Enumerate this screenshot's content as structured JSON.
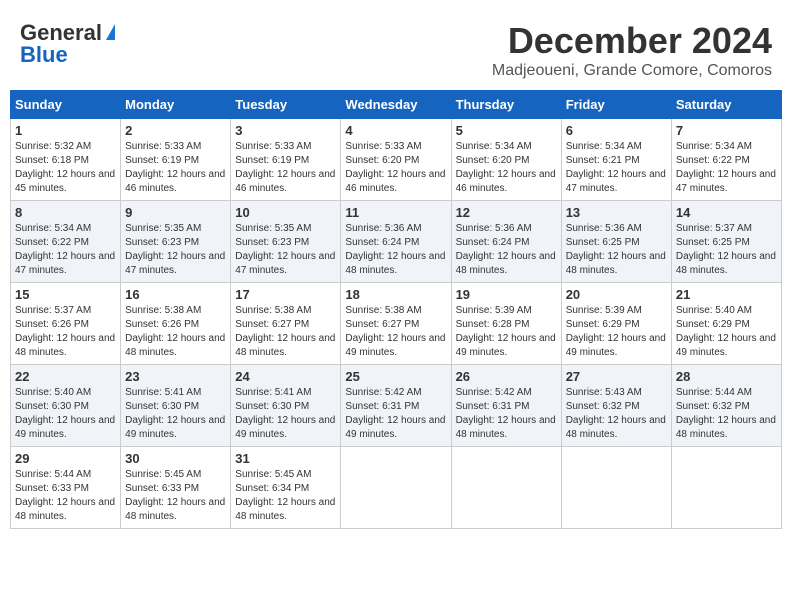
{
  "header": {
    "logo_line1": "General",
    "logo_line2": "Blue",
    "title": "December 2024",
    "subtitle": "Madjeoueni, Grande Comore, Comoros"
  },
  "calendar": {
    "days_of_week": [
      "Sunday",
      "Monday",
      "Tuesday",
      "Wednesday",
      "Thursday",
      "Friday",
      "Saturday"
    ],
    "weeks": [
      [
        null,
        {
          "day": "2",
          "sunrise": "5:33 AM",
          "sunset": "6:19 PM",
          "daylight": "12 hours and 46 minutes."
        },
        {
          "day": "3",
          "sunrise": "5:33 AM",
          "sunset": "6:19 PM",
          "daylight": "12 hours and 46 minutes."
        },
        {
          "day": "4",
          "sunrise": "5:33 AM",
          "sunset": "6:20 PM",
          "daylight": "12 hours and 46 minutes."
        },
        {
          "day": "5",
          "sunrise": "5:34 AM",
          "sunset": "6:20 PM",
          "daylight": "12 hours and 46 minutes."
        },
        {
          "day": "6",
          "sunrise": "5:34 AM",
          "sunset": "6:21 PM",
          "daylight": "12 hours and 47 minutes."
        },
        {
          "day": "7",
          "sunrise": "5:34 AM",
          "sunset": "6:22 PM",
          "daylight": "12 hours and 47 minutes."
        }
      ],
      [
        {
          "day": "1",
          "sunrise": "5:32 AM",
          "sunset": "6:18 PM",
          "daylight": "12 hours and 45 minutes."
        },
        {
          "day": "9",
          "sunrise": "5:35 AM",
          "sunset": "6:23 PM",
          "daylight": "12 hours and 47 minutes."
        },
        {
          "day": "10",
          "sunrise": "5:35 AM",
          "sunset": "6:23 PM",
          "daylight": "12 hours and 47 minutes."
        },
        {
          "day": "11",
          "sunrise": "5:36 AM",
          "sunset": "6:24 PM",
          "daylight": "12 hours and 48 minutes."
        },
        {
          "day": "12",
          "sunrise": "5:36 AM",
          "sunset": "6:24 PM",
          "daylight": "12 hours and 48 minutes."
        },
        {
          "day": "13",
          "sunrise": "5:36 AM",
          "sunset": "6:25 PM",
          "daylight": "12 hours and 48 minutes."
        },
        {
          "day": "14",
          "sunrise": "5:37 AM",
          "sunset": "6:25 PM",
          "daylight": "12 hours and 48 minutes."
        }
      ],
      [
        {
          "day": "8",
          "sunrise": "5:34 AM",
          "sunset": "6:22 PM",
          "daylight": "12 hours and 47 minutes."
        },
        {
          "day": "16",
          "sunrise": "5:38 AM",
          "sunset": "6:26 PM",
          "daylight": "12 hours and 48 minutes."
        },
        {
          "day": "17",
          "sunrise": "5:38 AM",
          "sunset": "6:27 PM",
          "daylight": "12 hours and 48 minutes."
        },
        {
          "day": "18",
          "sunrise": "5:38 AM",
          "sunset": "6:27 PM",
          "daylight": "12 hours and 49 minutes."
        },
        {
          "day": "19",
          "sunrise": "5:39 AM",
          "sunset": "6:28 PM",
          "daylight": "12 hours and 49 minutes."
        },
        {
          "day": "20",
          "sunrise": "5:39 AM",
          "sunset": "6:29 PM",
          "daylight": "12 hours and 49 minutes."
        },
        {
          "day": "21",
          "sunrise": "5:40 AM",
          "sunset": "6:29 PM",
          "daylight": "12 hours and 49 minutes."
        }
      ],
      [
        {
          "day": "15",
          "sunrise": "5:37 AM",
          "sunset": "6:26 PM",
          "daylight": "12 hours and 48 minutes."
        },
        {
          "day": "23",
          "sunrise": "5:41 AM",
          "sunset": "6:30 PM",
          "daylight": "12 hours and 49 minutes."
        },
        {
          "day": "24",
          "sunrise": "5:41 AM",
          "sunset": "6:30 PM",
          "daylight": "12 hours and 49 minutes."
        },
        {
          "day": "25",
          "sunrise": "5:42 AM",
          "sunset": "6:31 PM",
          "daylight": "12 hours and 49 minutes."
        },
        {
          "day": "26",
          "sunrise": "5:42 AM",
          "sunset": "6:31 PM",
          "daylight": "12 hours and 48 minutes."
        },
        {
          "day": "27",
          "sunrise": "5:43 AM",
          "sunset": "6:32 PM",
          "daylight": "12 hours and 48 minutes."
        },
        {
          "day": "28",
          "sunrise": "5:44 AM",
          "sunset": "6:32 PM",
          "daylight": "12 hours and 48 minutes."
        }
      ],
      [
        {
          "day": "22",
          "sunrise": "5:40 AM",
          "sunset": "6:30 PM",
          "daylight": "12 hours and 49 minutes."
        },
        {
          "day": "30",
          "sunrise": "5:45 AM",
          "sunset": "6:33 PM",
          "daylight": "12 hours and 48 minutes."
        },
        {
          "day": "31",
          "sunrise": "5:45 AM",
          "sunset": "6:34 PM",
          "daylight": "12 hours and 48 minutes."
        },
        null,
        null,
        null,
        null
      ],
      [
        {
          "day": "29",
          "sunrise": "5:44 AM",
          "sunset": "6:33 PM",
          "daylight": "12 hours and 48 minutes."
        },
        null,
        null,
        null,
        null,
        null,
        null
      ]
    ]
  }
}
